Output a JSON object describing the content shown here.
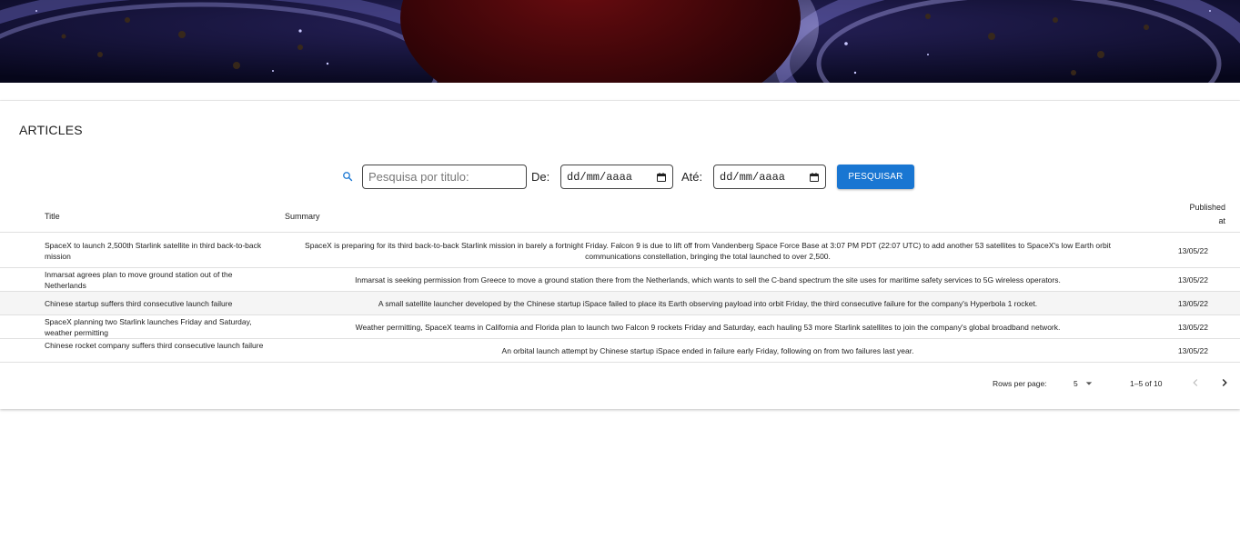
{
  "card": {
    "title": "ARTICLES"
  },
  "search": {
    "placeholder": "Pesquisa por titulo:",
    "from_label": "De:",
    "to_label": "Até:",
    "from_value": "dd/mm/aaaa",
    "to_value": "dd/mm/aaaa",
    "button_label": "PESQUISAR",
    "accent_color": "#1976d2"
  },
  "table": {
    "headers": {
      "title": "Title",
      "summary": "Summary",
      "published_line1": "Published",
      "published_line2": "at"
    },
    "rows": [
      {
        "title": "SpaceX to launch 2,500th Starlink satellite in third back-to-back mission",
        "summary": "SpaceX is preparing for its third back-to-back Starlink mission in barely a fortnight Friday. Falcon 9 is due to lift off from Vandenberg Space Force Base at 3:07 PM PDT (22:07 UTC) to add another 53 satellites to SpaceX's low Earth orbit communications constellation, bringing the total launched to over 2,500.",
        "date": "13/05/22"
      },
      {
        "title": "Inmarsat agrees plan to move ground station out of the Netherlands",
        "summary": "Inmarsat is seeking permission from Greece to move a ground station there from the Netherlands, which wants to sell the C-band spectrum the site uses for maritime safety services to 5G wireless operators.",
        "date": "13/05/22"
      },
      {
        "title": "Chinese startup suffers third consecutive launch failure",
        "summary": "A small satellite launcher developed by the Chinese startup iSpace failed to place its Earth observing payload into orbit Friday, the third consecutive failure for the company's Hyperbola 1 rocket.",
        "date": "13/05/22"
      },
      {
        "title": "SpaceX planning two Starlink launches Friday and Saturday, weather permitting",
        "summary": "Weather permitting, SpaceX teams in California and Florida plan to launch two Falcon 9 rockets Friday and Saturday, each hauling 53 more Starlink satellites to join the company's global broadband network.",
        "date": "13/05/22"
      },
      {
        "title": "Chinese rocket company suffers third consecutive launch failure",
        "summary": "An orbital launch attempt by Chinese startup iSpace ended in failure early Friday, following on from two failures last year.",
        "date": "13/05/22"
      }
    ]
  },
  "pagination": {
    "rows_per_page_label": "Rows per page:",
    "rows_per_page_value": "5",
    "range_label": "1–5 of 10"
  },
  "icons": {
    "search": "search-icon",
    "calendar": "calendar-icon",
    "dropdown": "arrow-drop-down-icon",
    "prev": "chevron-left-icon",
    "next": "chevron-right-icon"
  }
}
